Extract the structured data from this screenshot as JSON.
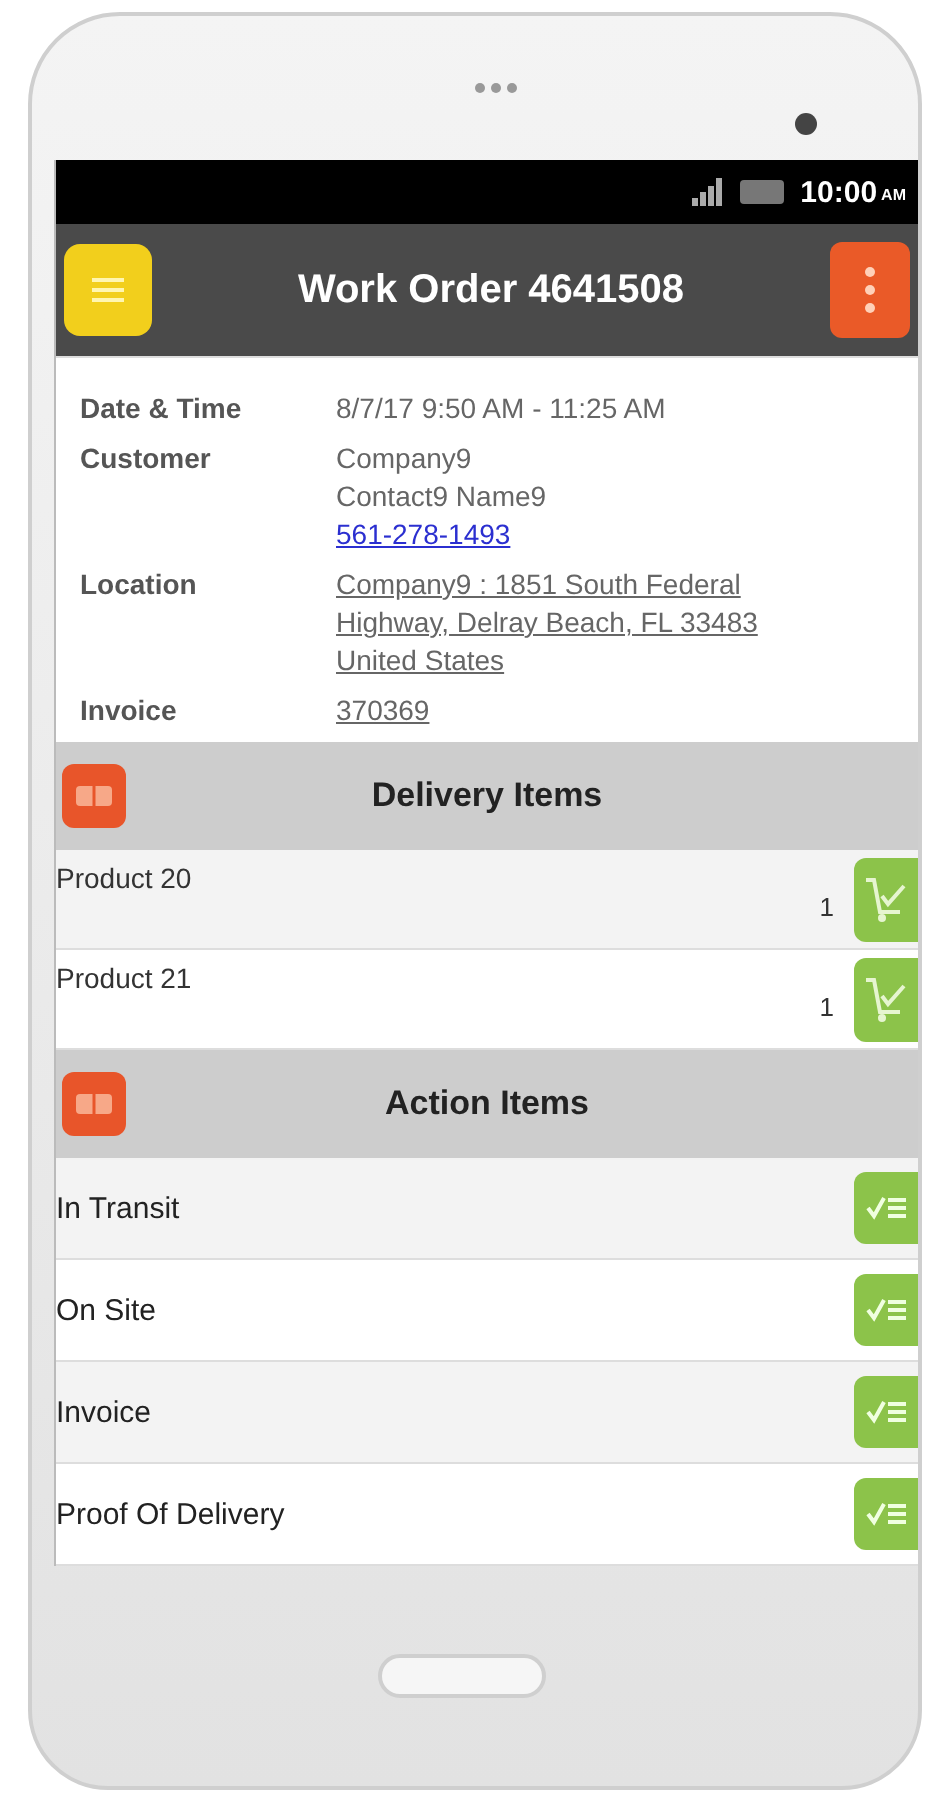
{
  "status_bar": {
    "time": "10:00",
    "meridiem": "AM"
  },
  "header": {
    "title": "Work Order 4641508"
  },
  "details": [
    {
      "label": "Date & Time",
      "lines": [
        {
          "kind": "plain",
          "text": "8/7/17 9:50 AM - 11:25 AM"
        }
      ]
    },
    {
      "label": "Customer",
      "lines": [
        {
          "kind": "plain",
          "text": "Company9"
        },
        {
          "kind": "plain",
          "text": "Contact9 Name9"
        },
        {
          "kind": "phone",
          "text": "561-278-1493"
        }
      ]
    },
    {
      "label": "Location",
      "lines": [
        {
          "kind": "link",
          "text": "Company9 : 1851 South Federal"
        },
        {
          "kind": "link",
          "text": "Highway, Delray Beach, FL 33483"
        },
        {
          "kind": "link",
          "text": "United States"
        }
      ]
    },
    {
      "label": "Invoice",
      "lines": [
        {
          "kind": "link",
          "text": "370369"
        }
      ]
    }
  ],
  "sections": [
    {
      "kind": "delivery",
      "title": "Delivery Items",
      "rows": [
        {
          "name": "Product 20",
          "quantity": "1"
        },
        {
          "name": "Product 21",
          "quantity": "1"
        }
      ]
    },
    {
      "kind": "action",
      "title": "Action Items",
      "rows": [
        {
          "name": "In Transit"
        },
        {
          "name": "On Site"
        },
        {
          "name": "Invoice"
        },
        {
          "name": "Proof Of Delivery"
        }
      ]
    }
  ]
}
